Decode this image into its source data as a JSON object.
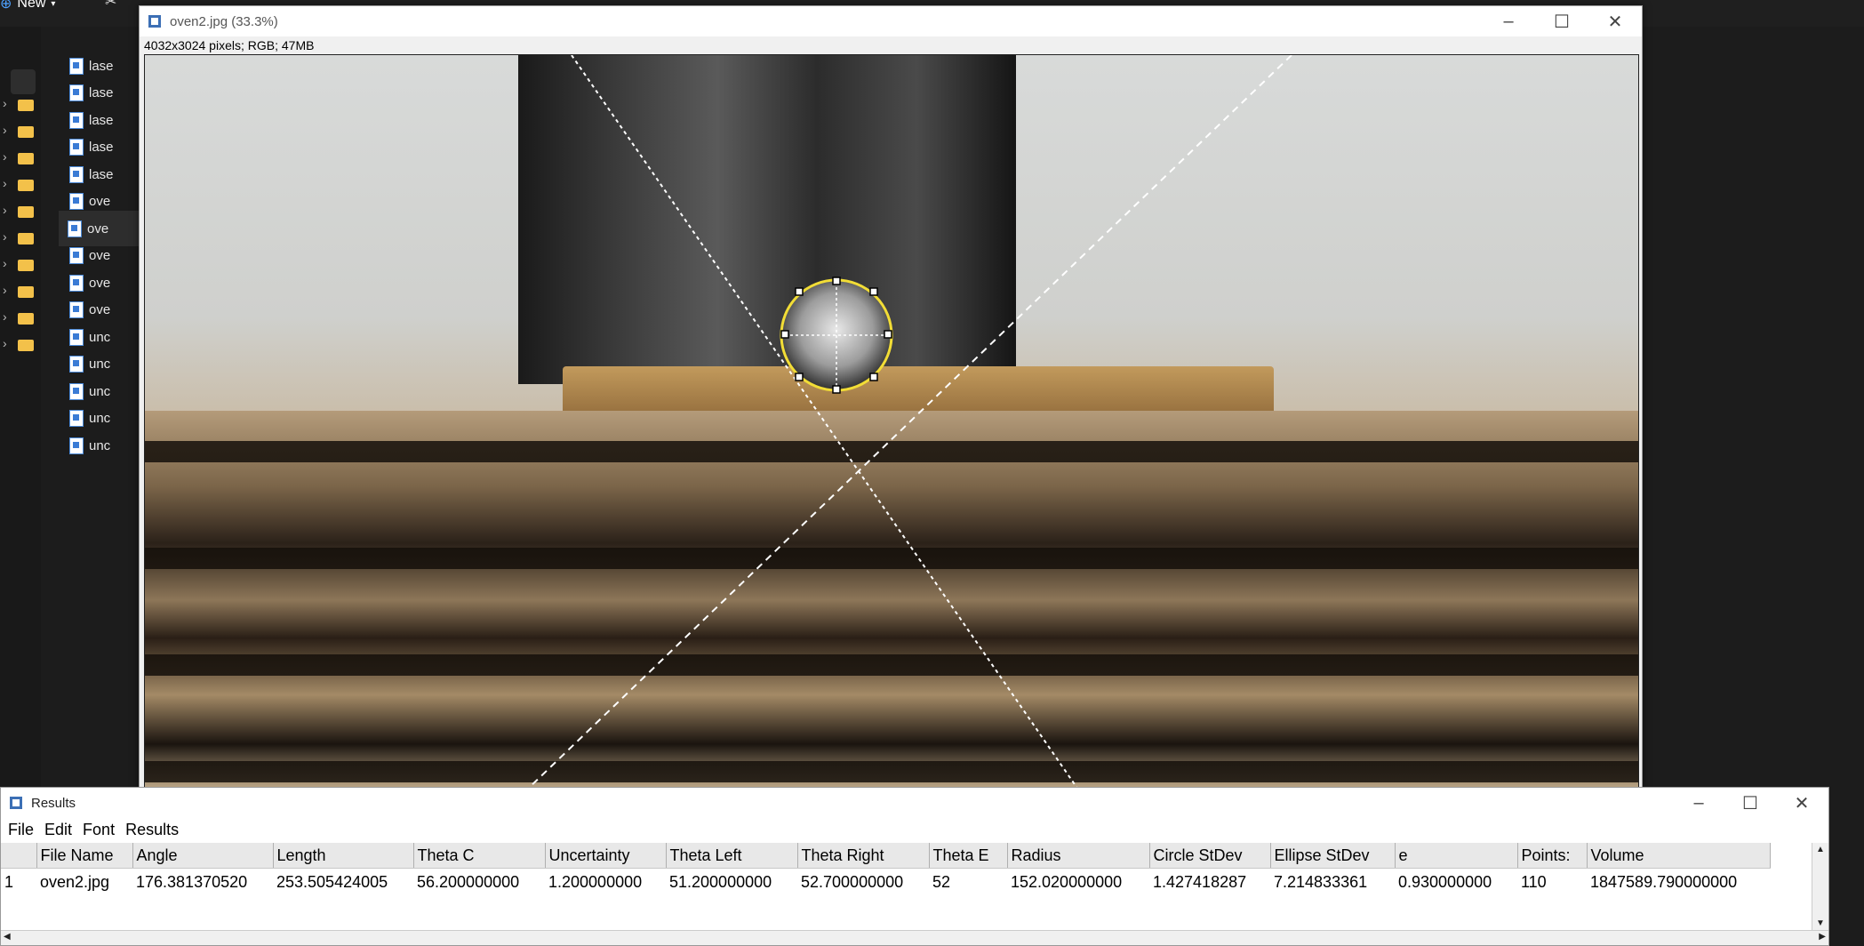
{
  "explorer": {
    "new_label": "New",
    "files": [
      "lase",
      "lase",
      "lase",
      "lase",
      "lase",
      "ove",
      "ove",
      "ove",
      "ove",
      "ove",
      "unc",
      "unc",
      "unc",
      "unc",
      "unc"
    ]
  },
  "image_window": {
    "title": "oven2.jpg (33.3%)",
    "info": "4032x3024 pixels; RGB; 47MB"
  },
  "results_window": {
    "title": "Results",
    "menu": [
      "File",
      "Edit",
      "Font",
      "Results"
    ],
    "columns": [
      "",
      "File Name",
      "Angle",
      "Length",
      "Theta C",
      "Uncertainty",
      "Theta Left",
      "Theta Right",
      "Theta E",
      "Radius",
      "Circle StDev",
      "Ellipse StDev",
      "e",
      "Points:",
      "Volume"
    ],
    "rows": [
      [
        "1",
        "oven2.jpg",
        "176.381370520",
        "253.505424005",
        "56.200000000",
        "1.200000000",
        "51.200000000",
        "52.700000000",
        "52",
        "152.020000000",
        "1.427418287",
        "7.214833361",
        "0.930000000",
        "110",
        "1847589.790000000"
      ]
    ]
  }
}
